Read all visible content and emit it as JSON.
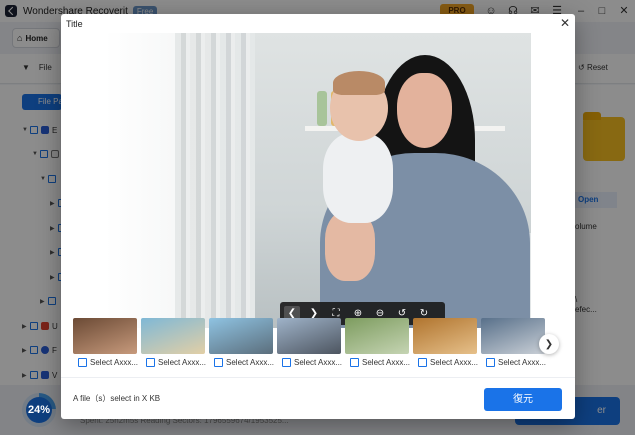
{
  "app": {
    "name": "Wondershare Recoverit",
    "free_badge": "Free",
    "pro_badge": "PRO",
    "icons": [
      "user-icon",
      "headset-icon",
      "mail-icon",
      "menu-icon",
      "minimize-icon",
      "maximize-icon",
      "close-icon"
    ]
  },
  "home_tab": {
    "label": "Home"
  },
  "filter_bar": {
    "filter_label": "File",
    "reset_label": "Reset"
  },
  "left_pane": {
    "filepath_button": "File Path",
    "tree_top": [
      "E",
      "U",
      "F",
      "V"
    ]
  },
  "right_pane": {
    "open_label": "Open",
    "volume_label": "olume",
    "path_line1": "\\",
    "path_line2": "efec..."
  },
  "bottom_bar": {
    "progress": "24%",
    "spent_text": "Spent: 25h2m5s   Reading Sectors: 1796559674/1953525..."
  },
  "dialog": {
    "title": "Title",
    "toolbar_icons": [
      "prev-icon",
      "next-icon",
      "fit-screen-icon",
      "zoom-in-icon",
      "zoom-out-icon",
      "rotate-left-icon",
      "rotate-right-icon"
    ],
    "thumbnails": [
      {
        "label": "Select Axxx...",
        "colors": [
          "#6b4a35",
          "#c79a7c"
        ]
      },
      {
        "label": "Select Axxx...",
        "colors": [
          "#7fb8d6",
          "#e2cfa6"
        ]
      },
      {
        "label": "Select Axxx...",
        "colors": [
          "#8fc3e2",
          "#5b6e7c"
        ]
      },
      {
        "label": "Select Axxx...",
        "colors": [
          "#9fb3c9",
          "#4d5560"
        ]
      },
      {
        "label": "Select Axxx...",
        "colors": [
          "#7d9c5f",
          "#c5d4b3"
        ]
      },
      {
        "label": "Select Axxx...",
        "colors": [
          "#b0742e",
          "#e6c08a"
        ]
      },
      {
        "label": "Select Axxx...",
        "colors": [
          "#58708a",
          "#c9cfd6"
        ]
      }
    ],
    "selection_info": "A file（s）select in X KB",
    "restore_button": "復元"
  }
}
